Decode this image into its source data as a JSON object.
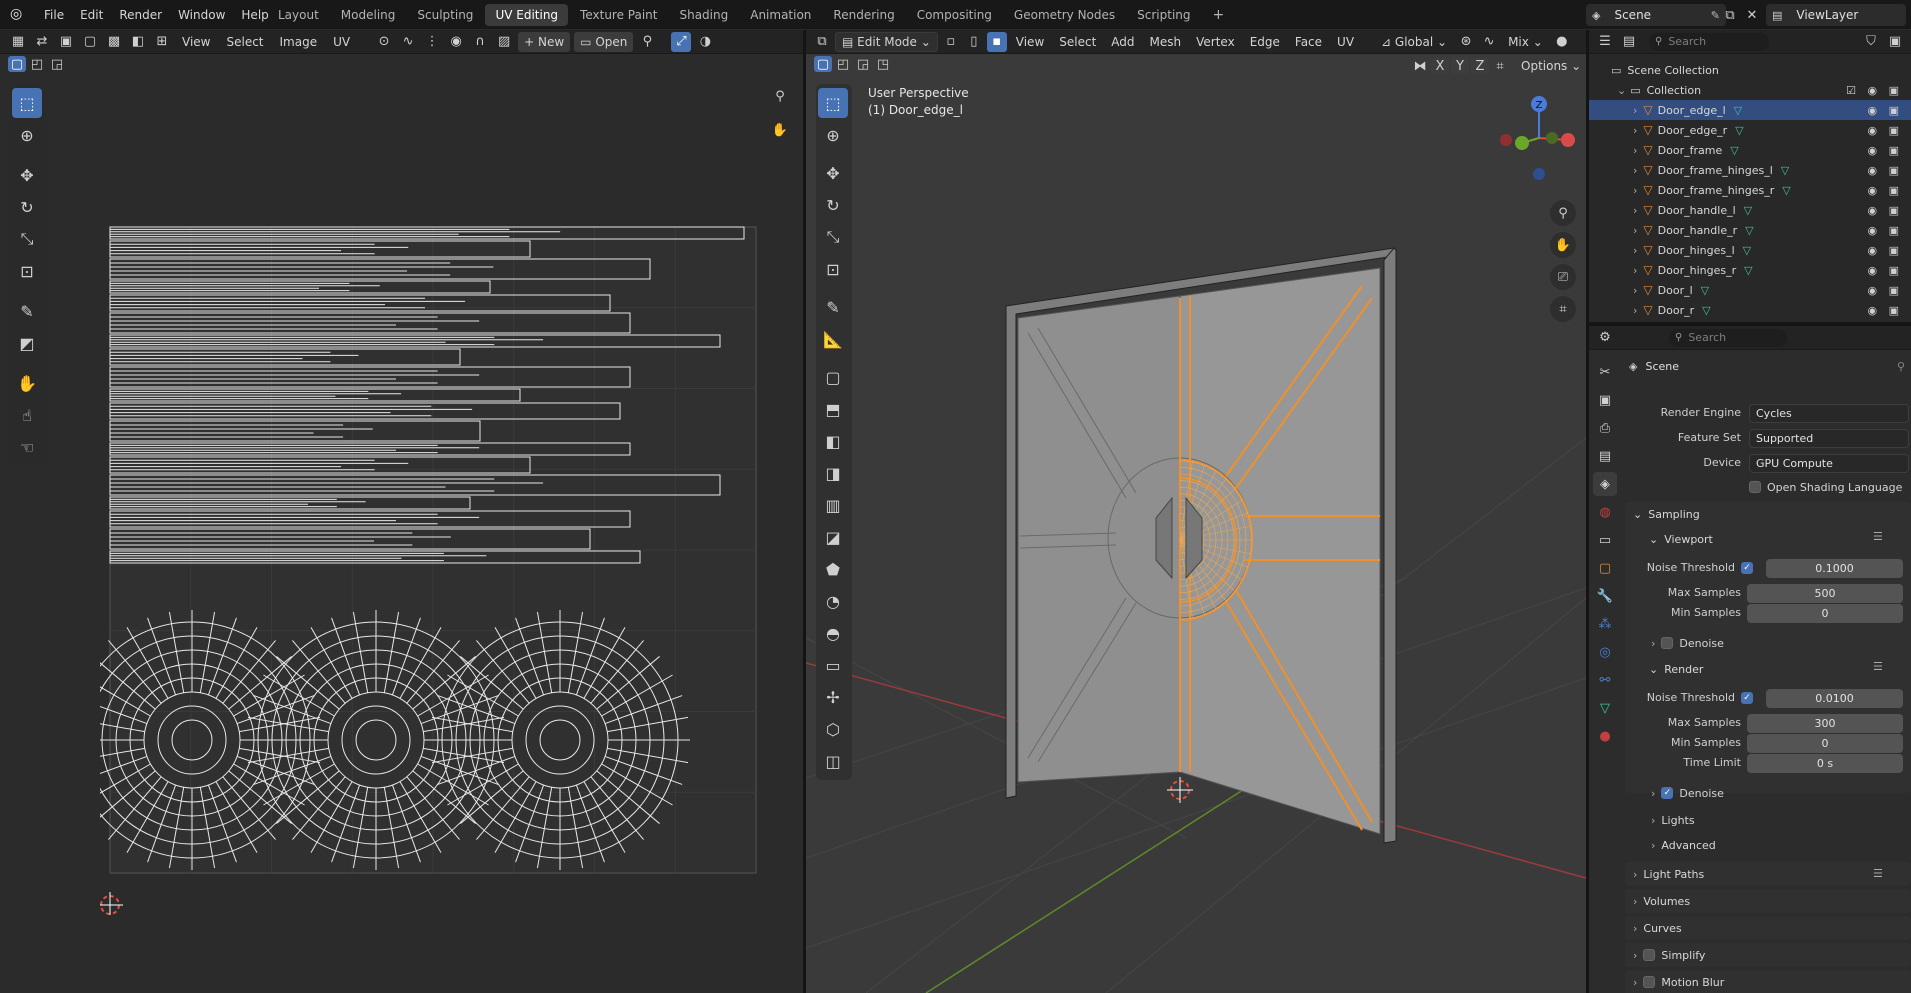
{
  "menu": [
    "File",
    "Edit",
    "Render",
    "Window",
    "Help"
  ],
  "workspaces": [
    "Layout",
    "Modeling",
    "Sculpting",
    "UV Editing",
    "Texture Paint",
    "Shading",
    "Animation",
    "Rendering",
    "Compositing",
    "Geometry Nodes",
    "Scripting"
  ],
  "active_workspace": "UV Editing",
  "top_right": {
    "scene": "Scene",
    "view_layer": "ViewLayer"
  },
  "uv_editor": {
    "menus": [
      "View",
      "Select",
      "Image",
      "UV"
    ],
    "new_label": "New",
    "open_label": "Open"
  },
  "viewport": {
    "mode": "Edit Mode",
    "menus": [
      "View",
      "Select",
      "Add",
      "Mesh",
      "Vertex",
      "Edge",
      "Face",
      "UV"
    ],
    "transform": "Global",
    "shading": "Mix",
    "options": "Options",
    "axes": [
      "X",
      "Y",
      "Z"
    ],
    "overlay_line1": "User Perspective",
    "overlay_line2": "(1) Door_edge_l",
    "gizmo": {
      "z": "Z"
    }
  },
  "outliner": {
    "search_placeholder": "Search",
    "root": "Scene Collection",
    "collection": "Collection",
    "items": [
      {
        "name": "Door_edge_l",
        "selected": true
      },
      {
        "name": "Door_edge_r",
        "selected": false
      },
      {
        "name": "Door_frame",
        "selected": false
      },
      {
        "name": "Door_frame_hinges_l",
        "selected": false
      },
      {
        "name": "Door_frame_hinges_r",
        "selected": false
      },
      {
        "name": "Door_handle_l",
        "selected": false
      },
      {
        "name": "Door_handle_r",
        "selected": false
      },
      {
        "name": "Door_hinges_l",
        "selected": false
      },
      {
        "name": "Door_hinges_r",
        "selected": false
      },
      {
        "name": "Door_l",
        "selected": false
      },
      {
        "name": "Door_r",
        "selected": false
      }
    ]
  },
  "properties": {
    "search_placeholder": "Search",
    "context": "Scene",
    "render_engine_label": "Render Engine",
    "render_engine": "Cycles",
    "feature_set_label": "Feature Set",
    "feature_set": "Supported",
    "device_label": "Device",
    "device": "GPU Compute",
    "osl_label": "Open Shading Language",
    "sampling": "Sampling",
    "viewport": "Viewport",
    "noise_threshold_label": "Noise Threshold",
    "viewport_noise": "0.1000",
    "max_samples_label": "Max Samples",
    "viewport_max": "500",
    "min_samples_label": "Min Samples",
    "viewport_min": "0",
    "denoise_label": "Denoise",
    "render": "Render",
    "render_noise": "0.0100",
    "render_max": "300",
    "render_min": "0",
    "time_limit_label": "Time Limit",
    "time_limit": "0 s",
    "lights": "Lights",
    "advanced": "Advanced",
    "light_paths": "Light Paths",
    "volumes": "Volumes",
    "curves": "Curves",
    "simplify": "Simplify",
    "motion_blur": "Motion Blur"
  }
}
